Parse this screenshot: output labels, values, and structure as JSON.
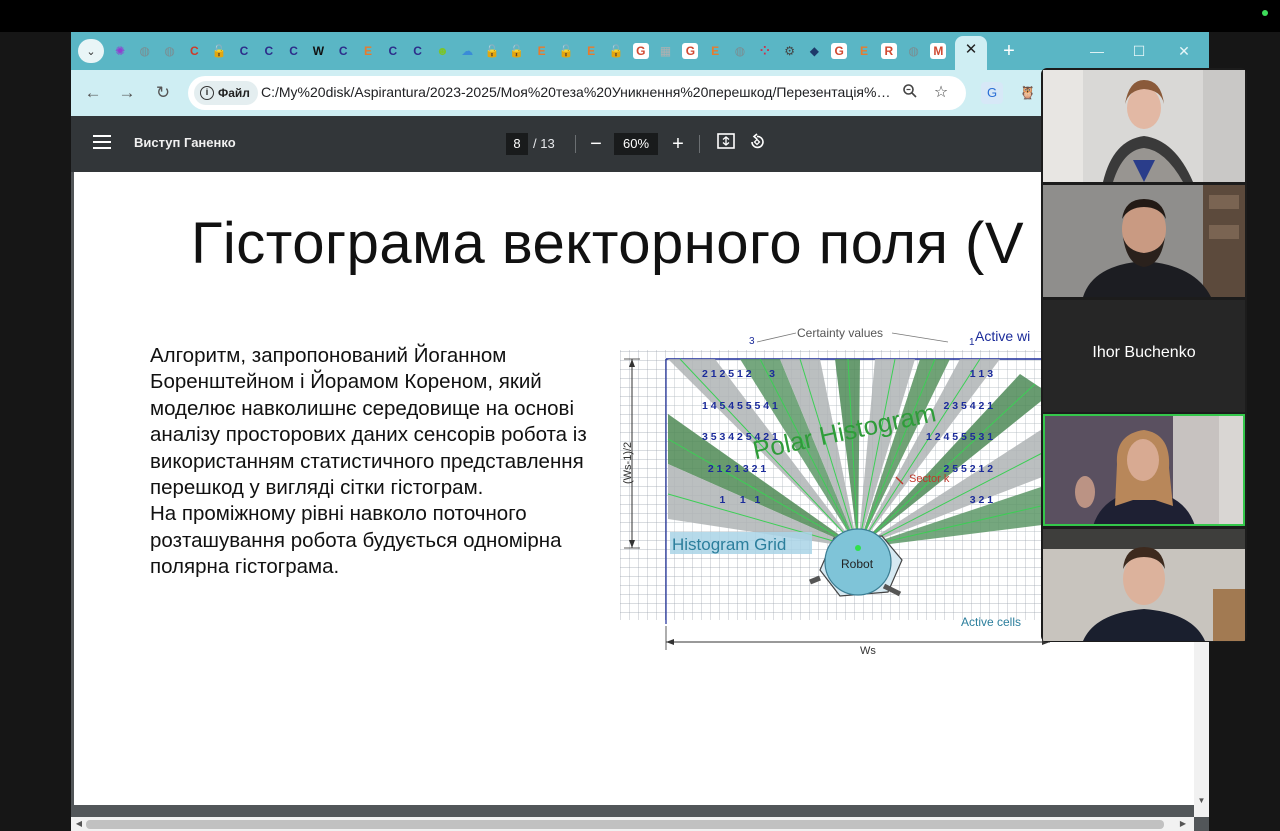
{
  "browser": {
    "favicons": [
      {
        "name": "kaleidoscope-favicon-icon",
        "color": "#8f3fd0",
        "glyph": "✺"
      },
      {
        "name": "globe-favicon-icon",
        "color": "#7b8c90",
        "glyph": "◍"
      },
      {
        "name": "globe-favicon-icon",
        "color": "#7b8c90",
        "glyph": "◍"
      },
      {
        "name": "red-c-favicon-icon",
        "color": "#d03a28",
        "glyph": "C"
      },
      {
        "name": "lock-favicon-icon",
        "color": "#5f6a6c",
        "glyph": "🔓"
      },
      {
        "name": "c-favicon-icon",
        "color": "#2d2d8a",
        "glyph": "C"
      },
      {
        "name": "c-favicon-icon",
        "color": "#2d2d8a",
        "glyph": "C"
      },
      {
        "name": "c-favicon-icon",
        "color": "#2d2d8a",
        "glyph": "C"
      },
      {
        "name": "wikipedia-favicon-icon",
        "color": "#111111",
        "glyph": "W"
      },
      {
        "name": "c-favicon-icon",
        "color": "#2d2d8a",
        "glyph": "C"
      },
      {
        "name": "elsevier-favicon-icon",
        "color": "#e87b2d",
        "glyph": "E"
      },
      {
        "name": "c-favicon-icon",
        "color": "#2d2d8a",
        "glyph": "C"
      },
      {
        "name": "c-favicon-icon",
        "color": "#2d2d8a",
        "glyph": "C"
      },
      {
        "name": "smiley-favicon-icon",
        "color": "#7cc42a",
        "glyph": "☻"
      },
      {
        "name": "cloud-favicon-icon",
        "color": "#3a8bd8",
        "glyph": "☁"
      },
      {
        "name": "lock-favicon-icon",
        "color": "#5f6a6c",
        "glyph": "🔓"
      },
      {
        "name": "lock-favicon-icon",
        "color": "#5f6a6c",
        "glyph": "🔓"
      },
      {
        "name": "elsevier-favicon-icon",
        "color": "#e87b2d",
        "glyph": "E"
      },
      {
        "name": "lock-favicon-icon",
        "color": "#5f6a6c",
        "glyph": "🔓"
      },
      {
        "name": "elsevier-favicon-icon",
        "color": "#e87b2d",
        "glyph": "E"
      },
      {
        "name": "lock-favicon-icon",
        "color": "#5f6a6c",
        "glyph": "🔓"
      },
      {
        "name": "google-favicon-icon",
        "color": "#ffffff",
        "glyph": "G"
      },
      {
        "name": "scihub-favicon-icon",
        "color": "#b0b0b0",
        "glyph": "▦"
      },
      {
        "name": "google-favicon-icon",
        "color": "#ffffff",
        "glyph": "G"
      },
      {
        "name": "elsevier-favicon-icon",
        "color": "#e87b2d",
        "glyph": "E"
      },
      {
        "name": "globe-favicon-icon",
        "color": "#7b8c90",
        "glyph": "◍"
      },
      {
        "name": "dots-favicon-icon",
        "color": "#d0304a",
        "glyph": "⁘"
      },
      {
        "name": "gear-favicon-icon",
        "color": "#444444",
        "glyph": "⚙"
      },
      {
        "name": "diamond-favicon-icon",
        "color": "#1d3a6a",
        "glyph": "◆"
      },
      {
        "name": "google-favicon-icon",
        "color": "#ffffff",
        "glyph": "G"
      },
      {
        "name": "elsevier-favicon-icon",
        "color": "#e87b2d",
        "glyph": "E"
      },
      {
        "name": "researchgate-favicon-icon",
        "color": "#ffffff",
        "glyph": "R"
      },
      {
        "name": "globe-favicon-icon",
        "color": "#7b8c90",
        "glyph": "◍"
      },
      {
        "name": "gmail-favicon-icon",
        "color": "#ffffff",
        "glyph": "M"
      }
    ],
    "url": "C:/My%20disk/Aspirantura/2023-2025/Моя%20теза%20Уникнення%20перешкод/Перезентація%20...",
    "file_chip_label": "Файл"
  },
  "pdf": {
    "title": "Виступ Ганенко",
    "current_page": "8",
    "total_pages": "/ 13",
    "zoom": "60%"
  },
  "slide": {
    "title": "Гістограма векторного поля (V",
    "paragraph1": "Алгоритм,  запропонований Йоганном Боренштейном і Йорамом Кореном, який моделює навколишнє середовище на основі аналізу просторових даних сенсорів робота із використанням статистичного представлення перешкод у вигляді сітки гістограм.",
    "paragraph2": "На проміжному рівні навколо поточного розташування робота будується одномірна полярна гістограма."
  },
  "figure": {
    "certainty_label": "Certainty values",
    "active_window_label": "Active wi",
    "polar_label": "Polar Histogram",
    "sector_label": "Sector k",
    "grid_label": "Histogram Grid",
    "robot_label": "Robot",
    "active_cells_label": "Active cells",
    "ws_label": "Ws",
    "ws_half_label": "(Ws-1)/2",
    "left_digits": [
      "2 1 2 5 1 2      3",
      "1 4 5 4 5 5 5 4 1",
      "3 5 3 4 2 5 4 2 1",
      "  2 1 2 1 3 2 1",
      "      1     1   1"
    ],
    "left_top_digit": "3",
    "right_digits": [
      "1 1 3",
      "2 3 5 4 2 1",
      "1 2 4 5 5 5 3 1",
      "2 5 5 2 1 2",
      "3 2 1"
    ],
    "right_top_digit": "1"
  },
  "participants": [
    {
      "name": "",
      "has_video": true
    },
    {
      "name": "",
      "has_video": true
    },
    {
      "name": "Ihor Buchenko",
      "has_video": false
    },
    {
      "name": "",
      "has_video": true,
      "speaking": true
    },
    {
      "name": "",
      "has_video": true
    }
  ]
}
